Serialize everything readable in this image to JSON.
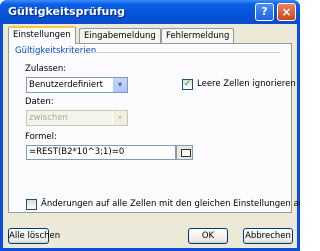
{
  "window": {
    "title": "Gültigkeitsprüfung",
    "help_label": "?",
    "close_label": "×"
  },
  "tabs": [
    {
      "label": "Einstellungen",
      "active": true
    },
    {
      "label": "Eingabemeldung",
      "active": false
    },
    {
      "label": "Fehlermeldung",
      "active": false
    }
  ],
  "criteria": {
    "section_title": "Gültigkeitskriterien",
    "allow_label": "Zulassen:",
    "allow_value": "Benutzerdefiniert",
    "ignore_blank_label": "Leere Zellen ignorieren",
    "ignore_blank_checked": true,
    "check_mark": "✓",
    "data_label": "Daten:",
    "data_value": "zwischen",
    "formula_label": "Formel:",
    "formula_value": "=REST(B2*10^3;1)=0"
  },
  "apply_all_label": "Änderungen auf alle Zellen mit den gleichen Einstellungen anwenden",
  "apply_all_checked": false,
  "buttons": {
    "clear_all": "Alle löschen",
    "ok": "OK",
    "cancel": "Abbrechen"
  },
  "icons": {
    "dropdown": "▾"
  }
}
